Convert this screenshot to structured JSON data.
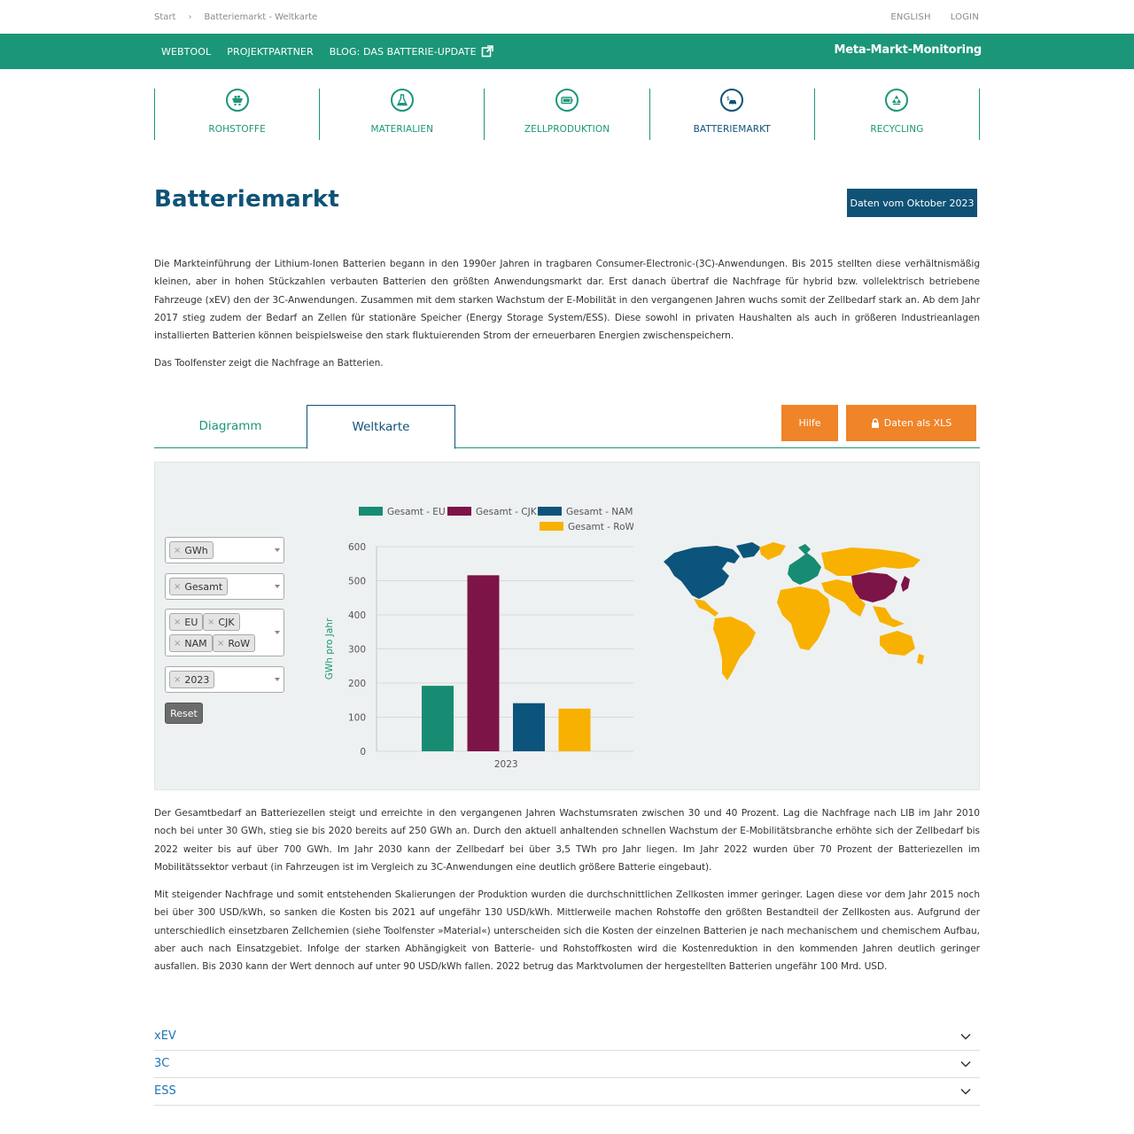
{
  "breadcrumb": {
    "home": "Start",
    "current": "Batteriemarkt - Weltkarte"
  },
  "toplinks": {
    "lang": "ENGLISH",
    "login": "LOGIN"
  },
  "nav": {
    "items": [
      "WEBTOOL",
      "PROJEKTPARTNER",
      "BLOG: DAS BATTERIE-UPDATE"
    ],
    "brand": "Meta-Markt-Monitoring"
  },
  "categories": [
    {
      "label": "ROHSTOFFE",
      "icon": "mining-cart-icon"
    },
    {
      "label": "MATERIALIEN",
      "icon": "flask-icon"
    },
    {
      "label": "ZELLPRODUKTION",
      "icon": "battery-cell-icon"
    },
    {
      "label": "BATTERIEMARKT",
      "icon": "car-battery-icon"
    },
    {
      "label": "RECYCLING",
      "icon": "recycling-icon"
    }
  ],
  "page": {
    "title": "Batteriemarkt",
    "date_button": "Daten vom Oktober 2023"
  },
  "intro": {
    "p1": "Die Markteinführung der Lithium-Ionen Batterien begann in den 1990er Jahren in tragbaren Consumer-Electronic-(3C)-Anwendungen. Bis 2015 stellten diese verhältnismäßig kleinen, aber in hohen Stückzahlen verbauten Batterien den größten Anwendungsmarkt dar. Erst danach übertraf die Nachfrage für hybrid bzw. vollelektrisch betriebene Fahrzeuge (xEV) den der 3C-Anwendungen. Zusammen mit dem starken Wachstum der E-Mobilität in den vergangenen Jahren wuchs somit der Zellbedarf stark an. Ab dem Jahr 2017 stieg zudem der Bedarf an Zellen für stationäre Speicher (Energy Storage System/ESS). Diese sowohl in privaten Haushalten als auch in größeren Industrieanlagen installierten Batterien können beispielsweise den stark fluktuierenden Strom der erneuerbaren Energien zwischenspeichern.",
    "p2": "Das Toolfenster zeigt die Nachfrage an Batterien."
  },
  "tabs": {
    "diagram": "Diagramm",
    "map": "Weltkarte",
    "help": "Hilfe",
    "xls": "Daten als XLS"
  },
  "filters": {
    "unit": "GWh",
    "type": "Gesamt",
    "regions": [
      "EU",
      "CJK",
      "NAM",
      "RoW"
    ],
    "year": "2023",
    "reset": "Reset",
    "remove_symbol": "×"
  },
  "colors": {
    "EU": "#178c72",
    "CJK": "#7d1447",
    "NAM": "#0c547c",
    "RoW": "#f8b100",
    "green": "#1b9679",
    "blue": "#0f5276",
    "orange": "#f08428"
  },
  "chart_data": {
    "type": "bar",
    "categories": [
      "2023"
    ],
    "series": [
      {
        "name": "Gesamt - EU",
        "values": [
          192
        ],
        "color": "#178c72"
      },
      {
        "name": "Gesamt - CJK",
        "values": [
          516
        ],
        "color": "#7d1447"
      },
      {
        "name": "Gesamt - NAM",
        "values": [
          141
        ],
        "color": "#0c547c"
      },
      {
        "name": "Gesamt - RoW",
        "values": [
          125
        ],
        "color": "#f8b100"
      }
    ],
    "ylabel": "GWh pro Jahr",
    "ylim": [
      0,
      600
    ],
    "yticks": [
      0,
      100,
      200,
      300,
      400,
      500,
      600
    ],
    "grid": true,
    "legend": "top"
  },
  "body": {
    "p3": "Der Gesamtbedarf an Batteriezellen steigt und erreichte in den vergangenen Jahren Wachstumsraten zwischen 30 und 40 Prozent. Lag die Nachfrage nach LIB im Jahr 2010 noch bei unter 30 GWh, stieg sie bis 2020 bereits auf 250 GWh an. Durch den aktuell anhaltenden schnellen Wachstum der E-Mobilitätsbranche erhöhte sich der Zellbedarf bis 2022 weiter bis auf über 700 GWh. Im Jahr 2030 kann der Zellbedarf bei über 3,5 TWh pro Jahr liegen. Im Jahr 2022 wurden über 70 Prozent der Batteriezellen im Mobilitätssektor verbaut (in Fahrzeugen ist im Vergleich zu 3C-Anwendungen eine deutlich größere Batterie eingebaut).",
    "p4": "Mit steigender Nachfrage und somit entstehenden Skalierungen der Produktion wurden die durchschnittlichen Zellkosten immer geringer. Lagen diese vor dem Jahr 2015 noch bei über 300 USD/kWh, so sanken die Kosten bis 2021 auf ungefähr 130 USD/kWh. Mittlerweile machen Rohstoffe den größten Bestandteil der Zellkosten aus. Aufgrund der unterschiedlich einsetzbaren Zellchemien (siehe Toolfenster »Material«) unterscheiden sich die Kosten der einzelnen Batterien je nach mechanischem und chemischem Aufbau, aber auch nach Einsatzgebiet. Infolge der starken Abhängigkeit von Batterie- und Rohstoffkosten wird die Kostenreduktion in den kommenden Jahren deutlich geringer ausfallen. Bis 2030 kann der Wert dennoch auf unter 90 USD/kWh fallen. 2022 betrug das Marktvolumen der hergestellten Batterien ungefähr 100 Mrd. USD."
  },
  "accordion": [
    "xEV",
    "3C",
    "ESS"
  ]
}
